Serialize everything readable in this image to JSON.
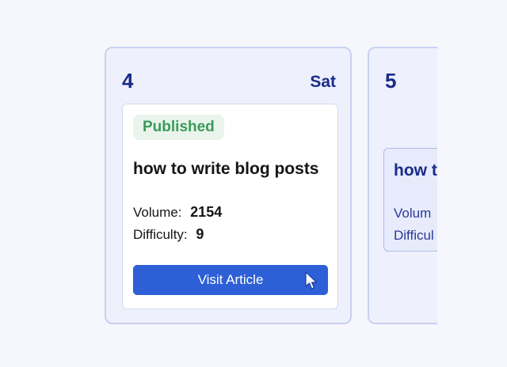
{
  "days": [
    {
      "number": "4",
      "name": "Sat",
      "card": {
        "status": "Published",
        "title": "how to write blog posts",
        "volume_label": "Volume:",
        "volume_value": "2154",
        "difficulty_label": "Difficulty:",
        "difficulty_value": "9",
        "button_label": "Visit Article",
        "button_icon": "pointer-cursor-icon"
      }
    },
    {
      "number": "5",
      "card": {
        "title": "how t",
        "volume_label": "Volum",
        "difficulty_label": "Difficul"
      }
    }
  ],
  "colors": {
    "accent": "#2d5fd6",
    "day_text": "#1a2b8a",
    "published_badge_bg": "#e9f4ec",
    "published_badge_text": "#3c9a5a",
    "column_bg": "#eef0fb"
  }
}
